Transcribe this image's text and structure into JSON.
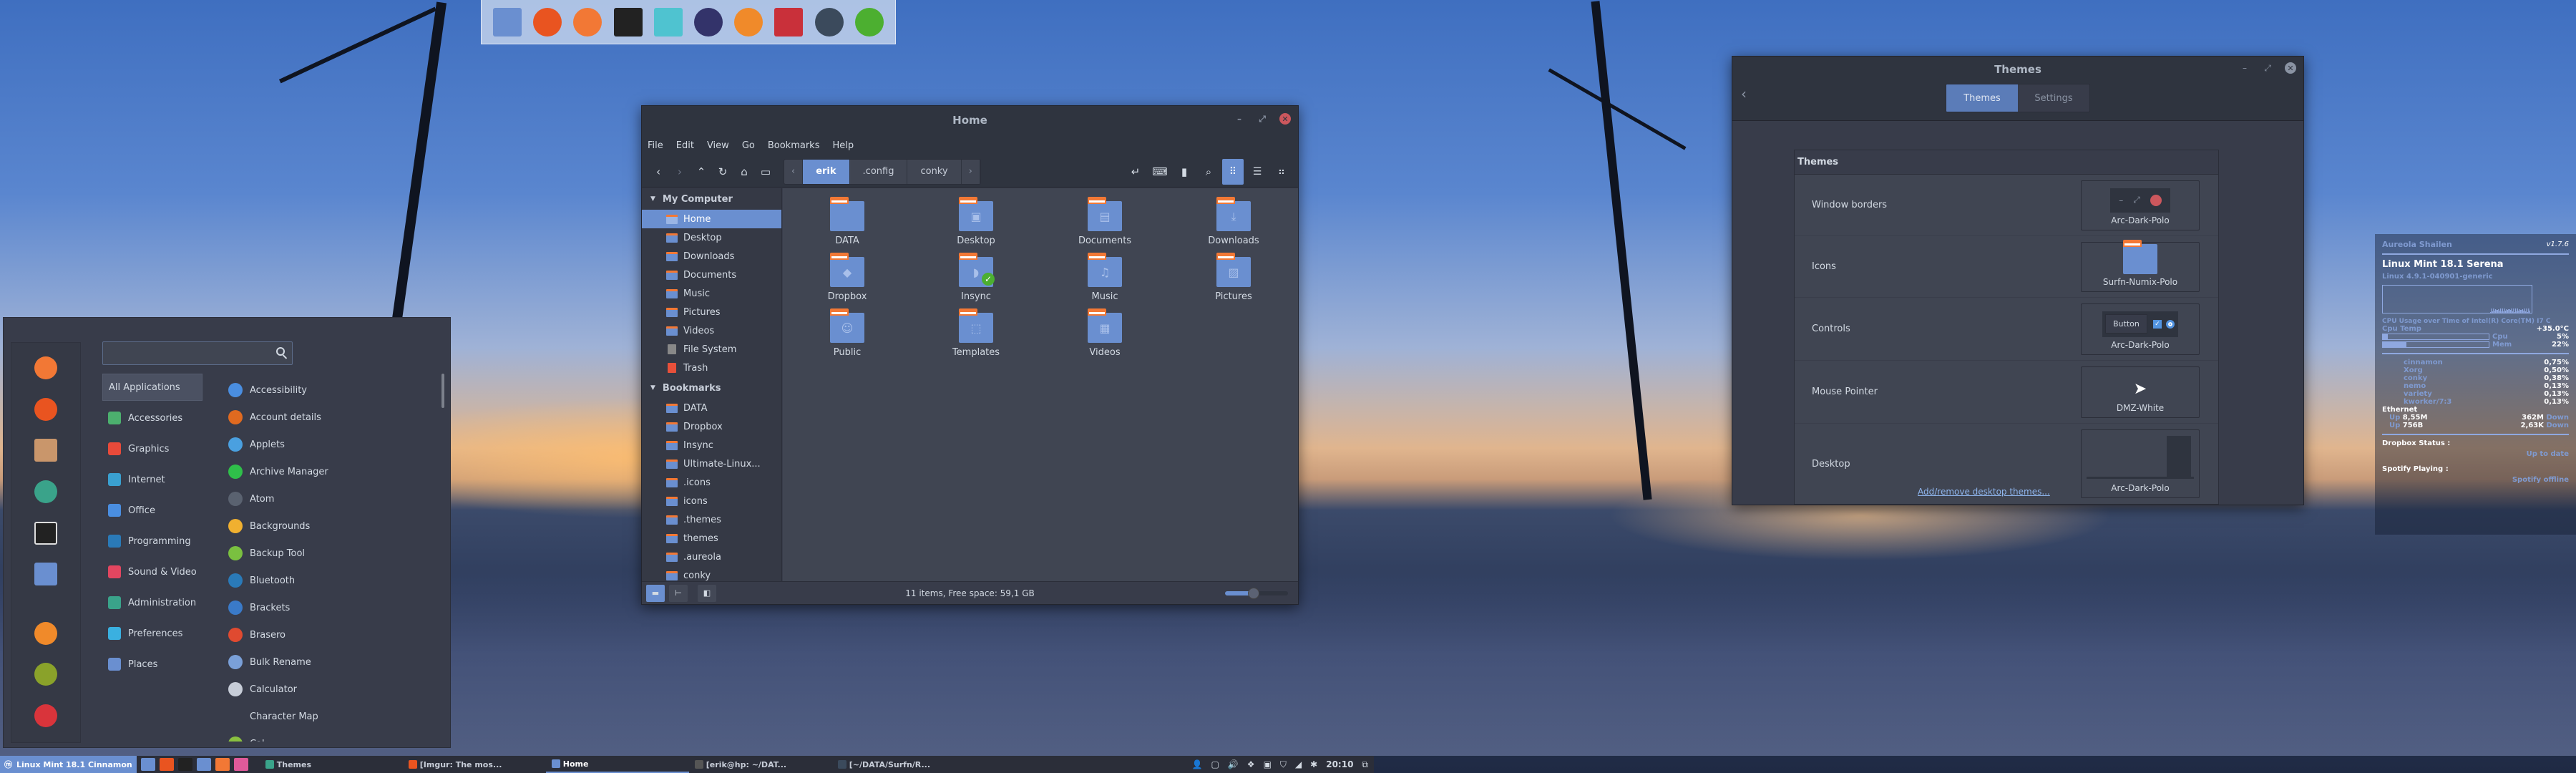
{
  "dock": {
    "items": [
      {
        "name": "files",
        "icon": "folder-icon",
        "color": "#6a8fd0"
      },
      {
        "name": "firefox",
        "icon": "firefox-icon",
        "color": "#e95420"
      },
      {
        "name": "rainbow",
        "icon": "rainbow-icon",
        "color": "#f27835"
      },
      {
        "name": "terminal",
        "icon": "terminal-icon",
        "color": "#222222"
      },
      {
        "name": "screenshot",
        "icon": "screenshot-icon",
        "color": "#4fc3d0"
      },
      {
        "name": "inkscape",
        "icon": "inkscape-icon",
        "color": "#33336a"
      },
      {
        "name": "gimp",
        "icon": "gimp-icon",
        "color": "#f08a2a"
      },
      {
        "name": "screencast",
        "icon": "screencast-icon",
        "color": "#c9303a"
      },
      {
        "name": "sublime",
        "icon": "sublime-icon",
        "color": "#3b4a5c"
      },
      {
        "name": "spotify",
        "icon": "spotify-icon",
        "color": "#4caf30"
      }
    ]
  },
  "menu": {
    "search_placeholder": "",
    "favorites": [
      {
        "icon": "rainbow-icon",
        "color": "#f27835"
      },
      {
        "icon": "firefox-icon",
        "color": "#e95420"
      },
      {
        "icon": "package-installer-icon",
        "color": "#c9966b"
      },
      {
        "icon": "settings-sliders-icon",
        "color": "#3aa38a"
      },
      {
        "icon": "terminal-icon",
        "color": "#222222"
      },
      {
        "icon": "folder-icon",
        "color": "#6a8fd0"
      }
    ],
    "session": [
      {
        "icon": "lock-icon",
        "color": "#f08a2a"
      },
      {
        "icon": "logout-icon",
        "color": "#8aa22a"
      },
      {
        "icon": "power-icon",
        "color": "#d9343b"
      }
    ],
    "categories": [
      {
        "label": "All Applications",
        "color": "",
        "active": true
      },
      {
        "label": "Accessories",
        "color": "#4cb06e"
      },
      {
        "label": "Graphics",
        "color": "#e94a3a"
      },
      {
        "label": "Internet",
        "color": "#3aa0d0"
      },
      {
        "label": "Office",
        "color": "#4a8ee0"
      },
      {
        "label": "Programming",
        "color": "#2a7ab8"
      },
      {
        "label": "Sound & Video",
        "color": "#e34660"
      },
      {
        "label": "Administration",
        "color": "#3aa38a"
      },
      {
        "label": "Preferences",
        "color": "#3ab0e0"
      },
      {
        "label": "Places",
        "color": "#6a8fd0"
      }
    ],
    "apps": [
      {
        "label": "Accessibility",
        "color": "#4a8ee0"
      },
      {
        "label": "Account details",
        "color": "#e06a20"
      },
      {
        "label": "Applets",
        "color": "#4aa0e0"
      },
      {
        "label": "Archive Manager",
        "color": "#2fbf4a"
      },
      {
        "label": "Atom",
        "color": "#5a6270"
      },
      {
        "label": "Backgrounds",
        "color": "#f0b030"
      },
      {
        "label": "Backup Tool",
        "color": "#7ac040"
      },
      {
        "label": "Bluetooth",
        "color": "#2a7ab8"
      },
      {
        "label": "Brackets",
        "color": "#3a7ac8"
      },
      {
        "label": "Brasero",
        "color": "#e04a30"
      },
      {
        "label": "Bulk Rename",
        "color": "#7aa0d8"
      },
      {
        "label": "Calculator",
        "color": "#c7cdd8"
      },
      {
        "label": "Character Map",
        "color": "#383c4a"
      },
      {
        "label": "Cal...",
        "color": "#8ac040"
      }
    ]
  },
  "filemanager": {
    "title": "Home",
    "menubar": [
      "File",
      "Edit",
      "View",
      "Go",
      "Bookmarks",
      "Help"
    ],
    "breadcrumbs": [
      {
        "label": "erik",
        "active": true
      },
      {
        "label": ".config",
        "active": false
      },
      {
        "label": "conky",
        "active": false
      }
    ],
    "sidebar": {
      "my_computer_label": "My Computer",
      "my_computer": [
        {
          "label": "Home",
          "active": true
        },
        {
          "label": "Desktop"
        },
        {
          "label": "Downloads"
        },
        {
          "label": "Documents"
        },
        {
          "label": "Music"
        },
        {
          "label": "Pictures"
        },
        {
          "label": "Videos"
        },
        {
          "label": "File System"
        },
        {
          "label": "Trash"
        }
      ],
      "bookmarks_label": "Bookmarks",
      "bookmarks": [
        {
          "label": "DATA"
        },
        {
          "label": "Dropbox"
        },
        {
          "label": "Insync"
        },
        {
          "label": "Ultimate-Linux..."
        },
        {
          "label": ".icons"
        },
        {
          "label": "icons"
        },
        {
          "label": ".themes"
        },
        {
          "label": "themes"
        },
        {
          "label": ".aureola"
        },
        {
          "label": "conky"
        }
      ]
    },
    "items": [
      {
        "label": "DATA",
        "glyph": ""
      },
      {
        "label": "Desktop",
        "glyph": "▣"
      },
      {
        "label": "Documents",
        "glyph": "▤"
      },
      {
        "label": "Downloads",
        "glyph": "⤓"
      },
      {
        "label": "Dropbox",
        "glyph": "◆"
      },
      {
        "label": "Insync",
        "glyph": "◗",
        "badge": "✓"
      },
      {
        "label": "Music",
        "glyph": "♫"
      },
      {
        "label": "Pictures",
        "glyph": "▨"
      },
      {
        "label": "Public",
        "glyph": "☺"
      },
      {
        "label": "Templates",
        "glyph": "⬚"
      },
      {
        "label": "Videos",
        "glyph": "▦"
      }
    ],
    "status": "11 items, Free space: 59,1 GB",
    "zoom_level": 0.45
  },
  "themes": {
    "title": "Themes",
    "tabs": [
      {
        "label": "Themes",
        "active": true
      },
      {
        "label": "Settings",
        "active": false
      }
    ],
    "section_title": "Themes",
    "rows": [
      {
        "label": "Window borders",
        "value": "Arc-Dark-Polo"
      },
      {
        "label": "Icons",
        "value": "Surfn-Numix-Polo"
      },
      {
        "label": "Controls",
        "value": "Arc-Dark-Polo",
        "button_label": "Button"
      },
      {
        "label": "Mouse Pointer",
        "value": "DMZ-White"
      },
      {
        "label": "Desktop",
        "value": "Arc-Dark-Polo"
      }
    ],
    "link": "Add/remove desktop themes..."
  },
  "conky": {
    "user": "Aureola Shailen",
    "version": "v1.7.6",
    "os": "Linux Mint 18.1 Serena",
    "kernel": "Linux 4.9.1-040901-generic",
    "graph_caption": "CPU Usage over Time of Intel(R) Core(TM) I7 C",
    "cpu_temp_label": "Cpu Temp",
    "cpu_temp": "+35.0°C",
    "cpu_label": "Cpu",
    "cpu_pct": "5%",
    "cpu_value": 5,
    "mem_label": "Mem",
    "mem_pct": "22%",
    "mem_value": 22,
    "processes": [
      {
        "name": "cinnamon",
        "pct": "0,75%"
      },
      {
        "name": "Xorg",
        "pct": "0,50%"
      },
      {
        "name": "conky",
        "pct": "0,38%"
      },
      {
        "name": "nemo",
        "pct": "0,13%"
      },
      {
        "name": "variety",
        "pct": "0,13%"
      },
      {
        "name": "kworker/7:3",
        "pct": "0,13%"
      }
    ],
    "ethernet_label": "Ethernet",
    "net": [
      {
        "up_label": "Up",
        "up": "8,55M",
        "down": "362M",
        "down_label": "Down"
      },
      {
        "up_label": "Up",
        "up": "756B",
        "down": "2,63K",
        "down_label": "Down"
      }
    ],
    "dropbox_label": "Dropbox Status :",
    "dropbox_status": "Up to date",
    "spotify_label": "Spotify Playing :",
    "spotify_status": "Spotify offline"
  },
  "panel": {
    "menu_label": "Linux Mint 18.1 Cinnamon",
    "launchers": [
      {
        "icon": "show-desktop-icon",
        "color": "#6a8fd0"
      },
      {
        "icon": "firefox-icon",
        "color": "#e95420"
      },
      {
        "icon": "terminal-icon",
        "color": "#222222"
      },
      {
        "icon": "folder-icon",
        "color": "#6a8fd0"
      },
      {
        "icon": "rainbow-icon",
        "color": "#f27835"
      },
      {
        "icon": "photos-icon",
        "color": "#e05a9a"
      }
    ],
    "tasks": [
      {
        "label": "Themes",
        "color": "#3aa38a",
        "active": false
      },
      {
        "label": "[Imgur: The mos...",
        "color": "#e95420",
        "active": false
      },
      {
        "label": "Home",
        "color": "#6a8fd0",
        "active": true
      },
      {
        "label": "[erik@hp: ~/DAT...",
        "color": "#555",
        "active": false
      },
      {
        "label": "[~/DATA/Surfn/R...",
        "color": "#3b4a5c",
        "active": false
      }
    ],
    "tray": [
      "user-icon",
      "removable-drive-icon",
      "volume-icon",
      "dropbox-icon",
      "photo-icon",
      "shield-icon",
      "network-icon",
      "bluetooth-icon"
    ],
    "clock": "20:10"
  }
}
